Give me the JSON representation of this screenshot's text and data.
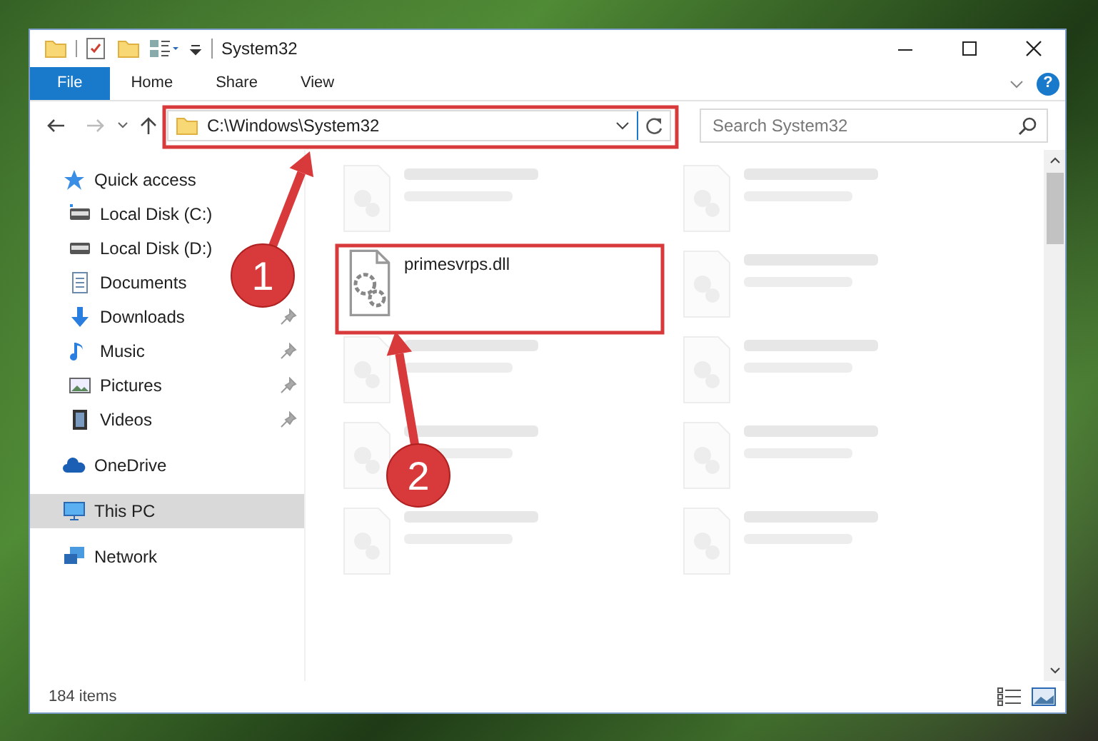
{
  "window": {
    "title": "System32"
  },
  "ribbon": {
    "tabs": [
      {
        "label": "File",
        "kind": "file"
      },
      {
        "label": "Home",
        "kind": "tab"
      },
      {
        "label": "Share",
        "kind": "tab"
      },
      {
        "label": "View",
        "kind": "tab"
      }
    ],
    "help": "?"
  },
  "address_bar": {
    "path": "C:\\Windows\\System32"
  },
  "search": {
    "placeholder": "Search System32"
  },
  "navigation": [
    {
      "label": "Quick access",
      "selected": false,
      "children": [
        {
          "label": "Local Disk (C:)",
          "pinned": false,
          "selected": false
        },
        {
          "label": "Local Disk (D:)",
          "pinned": false,
          "selected": false
        },
        {
          "label": "Documents",
          "pinned": false,
          "selected": false
        },
        {
          "label": "Downloads",
          "pinned": true,
          "selected": false
        },
        {
          "label": "Music",
          "pinned": true,
          "selected": false
        },
        {
          "label": "Pictures",
          "pinned": true,
          "selected": false
        },
        {
          "label": "Videos",
          "pinned": true,
          "selected": false
        }
      ]
    },
    {
      "label": "OneDrive",
      "selected": false
    },
    {
      "label": "This PC",
      "selected": true
    },
    {
      "label": "Network",
      "selected": false
    }
  ],
  "files": [
    {
      "kind": "blurred"
    },
    {
      "kind": "blurred"
    },
    {
      "kind": "file",
      "name": "primesvrps.dll"
    },
    {
      "kind": "blurred"
    },
    {
      "kind": "blurred"
    },
    {
      "kind": "blurred"
    },
    {
      "kind": "blurred"
    },
    {
      "kind": "blurred"
    },
    {
      "kind": "blurred"
    },
    {
      "kind": "blurred"
    }
  ],
  "status_bar": {
    "item_count": "184 items"
  },
  "annotations": [
    {
      "label": "1"
    },
    {
      "label": "2"
    }
  ]
}
